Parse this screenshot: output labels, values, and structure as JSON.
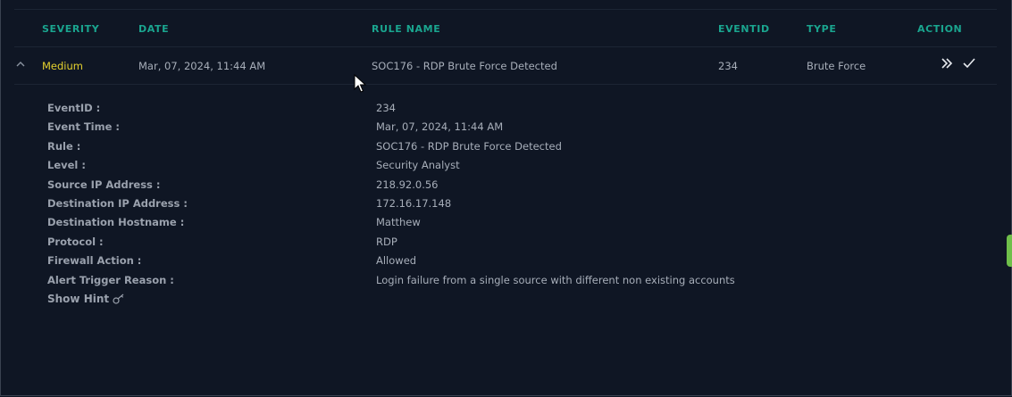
{
  "table": {
    "headers": {
      "severity": "SEVERITY",
      "date": "DATE",
      "rule_name": "RULE NAME",
      "eventid": "EVENTID",
      "type": "TYPE",
      "action": "ACTION"
    },
    "row": {
      "severity": "Medium",
      "date": "Mar, 07, 2024, 11:44 AM",
      "rule_name": "SOC176 - RDP Brute Force Detected",
      "eventid": "234",
      "type": "Brute Force"
    }
  },
  "details": [
    {
      "label": "EventID :",
      "value": "234"
    },
    {
      "label": "Event Time :",
      "value": "Mar, 07, 2024, 11:44 AM"
    },
    {
      "label": "Rule :",
      "value": "SOC176 - RDP Brute Force Detected"
    },
    {
      "label": "Level :",
      "value": "Security Analyst"
    },
    {
      "label": "Source IP Address :",
      "value": "218.92.0.56"
    },
    {
      "label": "Destination IP Address :",
      "value": "172.16.17.148"
    },
    {
      "label": "Destination Hostname :",
      "value": "Matthew"
    },
    {
      "label": "Protocol :",
      "value": "RDP"
    },
    {
      "label": "Firewall Action :",
      "value": "Allowed"
    },
    {
      "label": "Alert Trigger Reason :",
      "value": "Login failure from a single source with different non existing accounts"
    }
  ],
  "hint": {
    "label": "Show Hint",
    "icon": "key-icon"
  },
  "colors": {
    "background": "#0f1624",
    "header_text": "#1aa58f",
    "severity_medium": "#e4d02e",
    "text": "#a7aeb9",
    "side_tab": "#6fbf4a"
  },
  "icons": {
    "collapse": "chevron-up-icon",
    "escalate": "double-chevron-right-icon",
    "close_alert": "checkmark-icon"
  }
}
